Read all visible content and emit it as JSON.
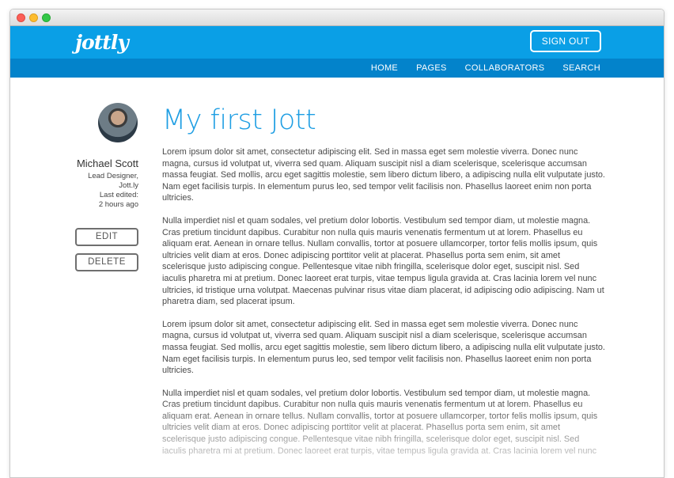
{
  "window": {
    "controls": [
      "close",
      "minimize",
      "zoom"
    ]
  },
  "header": {
    "logo": "jottly",
    "signout_label": "SIGN OUT",
    "nav": [
      "HOME",
      "PAGES",
      "COLLABORATORS",
      "SEARCH"
    ],
    "colors": {
      "top": "#0a9fe6",
      "nav": "#0383cb"
    }
  },
  "author": {
    "name": "Michael Scott",
    "role": "Lead Designer,",
    "company": "Jott.ly",
    "edited_label": "Last edited:",
    "edited_time": "2 hours ago"
  },
  "actions": {
    "edit_label": "EDIT",
    "delete_label": "DELETE"
  },
  "doc": {
    "title": "My first Jott",
    "paragraphs": [
      "Lorem ipsum dolor sit amet, consectetur adipiscing elit. Sed in massa eget sem molestie viverra. Donec nunc magna, cursus id volutpat ut, viverra sed quam. Aliquam suscipit nisl a diam scelerisque, scelerisque accumsan massa feugiat. Sed mollis, arcu eget sagittis molestie, sem libero dictum libero, a adipiscing nulla elit vulputate justo. Nam eget facilisis turpis. In elementum purus leo, sed tempor velit facilisis non. Phasellus laoreet enim non porta ultricies.",
      "Nulla imperdiet nisl et quam sodales, vel pretium dolor lobortis. Vestibulum sed tempor diam, ut molestie magna. Cras pretium tincidunt dapibus. Curabitur non nulla quis mauris venenatis fermentum ut at lorem. Phasellus eu aliquam erat. Aenean in ornare tellus. Nullam convallis, tortor at posuere ullamcorper, tortor felis mollis ipsum, quis ultricies velit diam at eros. Donec adipiscing porttitor velit at placerat. Phasellus porta sem enim, sit amet scelerisque justo adipiscing congue. Pellentesque vitae nibh fringilla, scelerisque dolor eget, suscipit nisl. Sed iaculis pharetra mi at pretium. Donec laoreet erat turpis, vitae tempus ligula gravida at. Cras lacinia lorem vel nunc ultricies, id tristique urna volutpat. Maecenas pulvinar risus vitae diam placerat, id adipiscing odio adipiscing. Nam ut pharetra diam, sed placerat ipsum.",
      "Lorem ipsum dolor sit amet, consectetur adipiscing elit. Sed in massa eget sem molestie viverra. Donec nunc magna, cursus id volutpat ut, viverra sed quam. Aliquam suscipit nisl a diam scelerisque, scelerisque accumsan massa feugiat. Sed mollis, arcu eget sagittis molestie, sem libero dictum libero, a adipiscing nulla elit vulputate justo. Nam eget facilisis turpis. In elementum purus leo, sed tempor velit facilisis non. Phasellus laoreet enim non porta ultricies.",
      "Nulla imperdiet nisl et quam sodales, vel pretium dolor lobortis. Vestibulum sed tempor diam, ut molestie magna. Cras pretium tincidunt dapibus. Curabitur non nulla quis mauris venenatis fermentum ut at lorem. Phasellus eu aliquam erat. Aenean in ornare tellus. Nullam convallis, tortor at posuere ullamcorper, tortor felis mollis ipsum, quis ultricies velit diam at eros. Donec adipiscing porttitor velit at placerat. Phasellus porta sem enim, sit amet scelerisque justo adipiscing congue. Pellentesque vitae nibh fringilla, scelerisque dolor eget, suscipit nisl. Sed iaculis pharetra mi at pretium. Donec laoreet erat turpis, vitae tempus ligula gravida at. Cras lacinia lorem vel nunc"
    ]
  }
}
